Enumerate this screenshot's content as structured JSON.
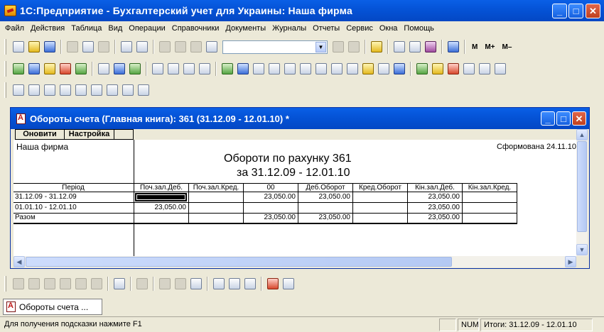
{
  "app": {
    "title": "1С:Предприятие - Бухгалтерский учет для Украины: Наша фирма",
    "window_buttons": [
      "_",
      "□",
      "✕"
    ]
  },
  "menu": [
    {
      "label": "Файл"
    },
    {
      "label": "Действия"
    },
    {
      "label": "Таблица"
    },
    {
      "label": "Вид"
    },
    {
      "label": "Операции"
    },
    {
      "label": "Справочники"
    },
    {
      "label": "Документы"
    },
    {
      "label": "Журналы"
    },
    {
      "label": "Отчеты"
    },
    {
      "label": "Сервис"
    },
    {
      "label": "Окна"
    },
    {
      "label": "Помощь"
    }
  ],
  "toolbar": {
    "search_combo_value": "",
    "m_label": "M",
    "mplus_label": "M+",
    "mminus_label": "M–"
  },
  "child_window": {
    "title": "Обороты счета (Главная книга): 361 (31.12.09 - 12.01.10)  *",
    "panel": {
      "refresh": "Оновити",
      "settings": "Настройка"
    }
  },
  "report": {
    "firm": "Наша фирма",
    "generated": "Сформована 24.11.10",
    "title": "Обороти по рахунку 361",
    "period_line": "за 31.12.09 - 12.01.10",
    "columns": [
      "Період",
      "Поч.зал.Деб.",
      "Поч.зал.Кред.",
      "00",
      "Деб.Оборот",
      "Кред.Оборот",
      "Кін.зал.Деб.",
      "Кін.зал.Кред."
    ],
    "rows": [
      {
        "period": "31.12.09 - 31.12.09",
        "beg_deb": "",
        "beg_cred": "",
        "c00": "23,050.00",
        "turn_deb": "23,050.00",
        "turn_cred": "",
        "end_deb": "23,050.00",
        "end_cred": ""
      },
      {
        "period": "01.01.10 - 12.01.10",
        "beg_deb": "23,050.00",
        "beg_cred": "",
        "c00": "",
        "turn_deb": "",
        "turn_cred": "",
        "end_deb": "23,050.00",
        "end_cred": ""
      },
      {
        "period": "Разом",
        "beg_deb": "",
        "beg_cred": "",
        "c00": "23,050.00",
        "turn_deb": "23,050.00",
        "turn_cred": "",
        "end_deb": "23,050.00",
        "end_cred": ""
      }
    ]
  },
  "taskbar": {
    "item": "Обороты счета ..."
  },
  "status": {
    "hint": "Для получения подсказки нажмите F1",
    "num": "NUM",
    "totals": "Итоги: 31.12.09 - 12.01.10"
  }
}
